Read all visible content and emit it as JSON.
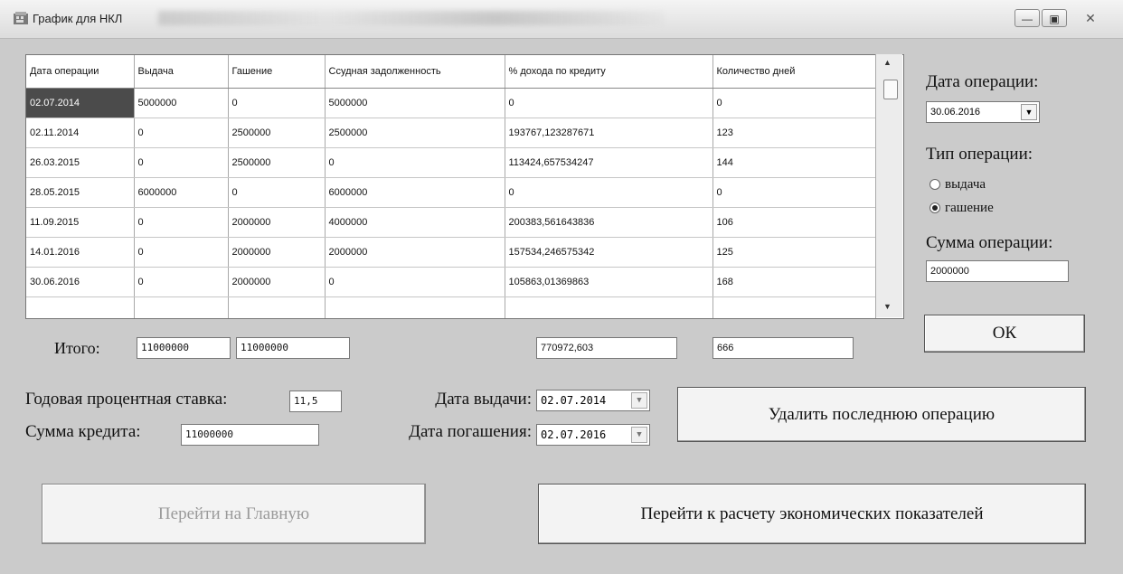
{
  "window": {
    "title": "График для НКЛ",
    "minimize": "—",
    "maximize": "▣",
    "close": "✕"
  },
  "grid": {
    "columns": [
      "Дата операции",
      "Выдача",
      "Гашение",
      "Ссудная задолженность",
      "% дохода по кредиту",
      "Количество дней"
    ],
    "rows": [
      [
        "02.07.2014",
        "5000000",
        "0",
        "5000000",
        "0",
        "0"
      ],
      [
        "02.11.2014",
        "0",
        "2500000",
        "2500000",
        "193767,123287671",
        "123"
      ],
      [
        "26.03.2015",
        "0",
        "2500000",
        "0",
        "113424,657534247",
        "144"
      ],
      [
        "28.05.2015",
        "6000000",
        "0",
        "6000000",
        "0",
        "0"
      ],
      [
        "11.09.2015",
        "0",
        "2000000",
        "4000000",
        "200383,561643836",
        "106"
      ],
      [
        "14.01.2016",
        "0",
        "2000000",
        "2000000",
        "157534,246575342",
        "125"
      ],
      [
        "30.06.2016",
        "0",
        "2000000",
        "0",
        "105863,01369863",
        "168"
      ],
      [
        "",
        "",
        "",
        "",
        "",
        ""
      ]
    ],
    "selected_cell": "02.07.2014"
  },
  "side": {
    "date_label": "Дата операции:",
    "date_value": "30.06.2016",
    "type_label": "Тип операции:",
    "radio_issue": "выдача",
    "radio_repay": "гашение",
    "selected_type": "гашение",
    "sum_label": "Сумма операции:",
    "sum_value": "2000000",
    "ok": "ОК"
  },
  "totals": {
    "label": "Итого:",
    "issue": "11000000",
    "repay": "11000000",
    "income": "770972,603",
    "days": "666"
  },
  "params": {
    "rate_label": "Годовая процентная ставка:",
    "rate_value": "11,5",
    "credit_label": "Сумма кредита:",
    "credit_value": "11000000",
    "issue_date_label": "Дата выдачи:",
    "issue_date_value": "02.07.2014",
    "repay_date_label": "Дата погашения:",
    "repay_date_value": "02.07.2016"
  },
  "buttons": {
    "delete_last": "Удалить последнюю операцию",
    "to_main": "Перейти на Главную",
    "to_economics": "Перейти к расчету экономических показателей"
  }
}
